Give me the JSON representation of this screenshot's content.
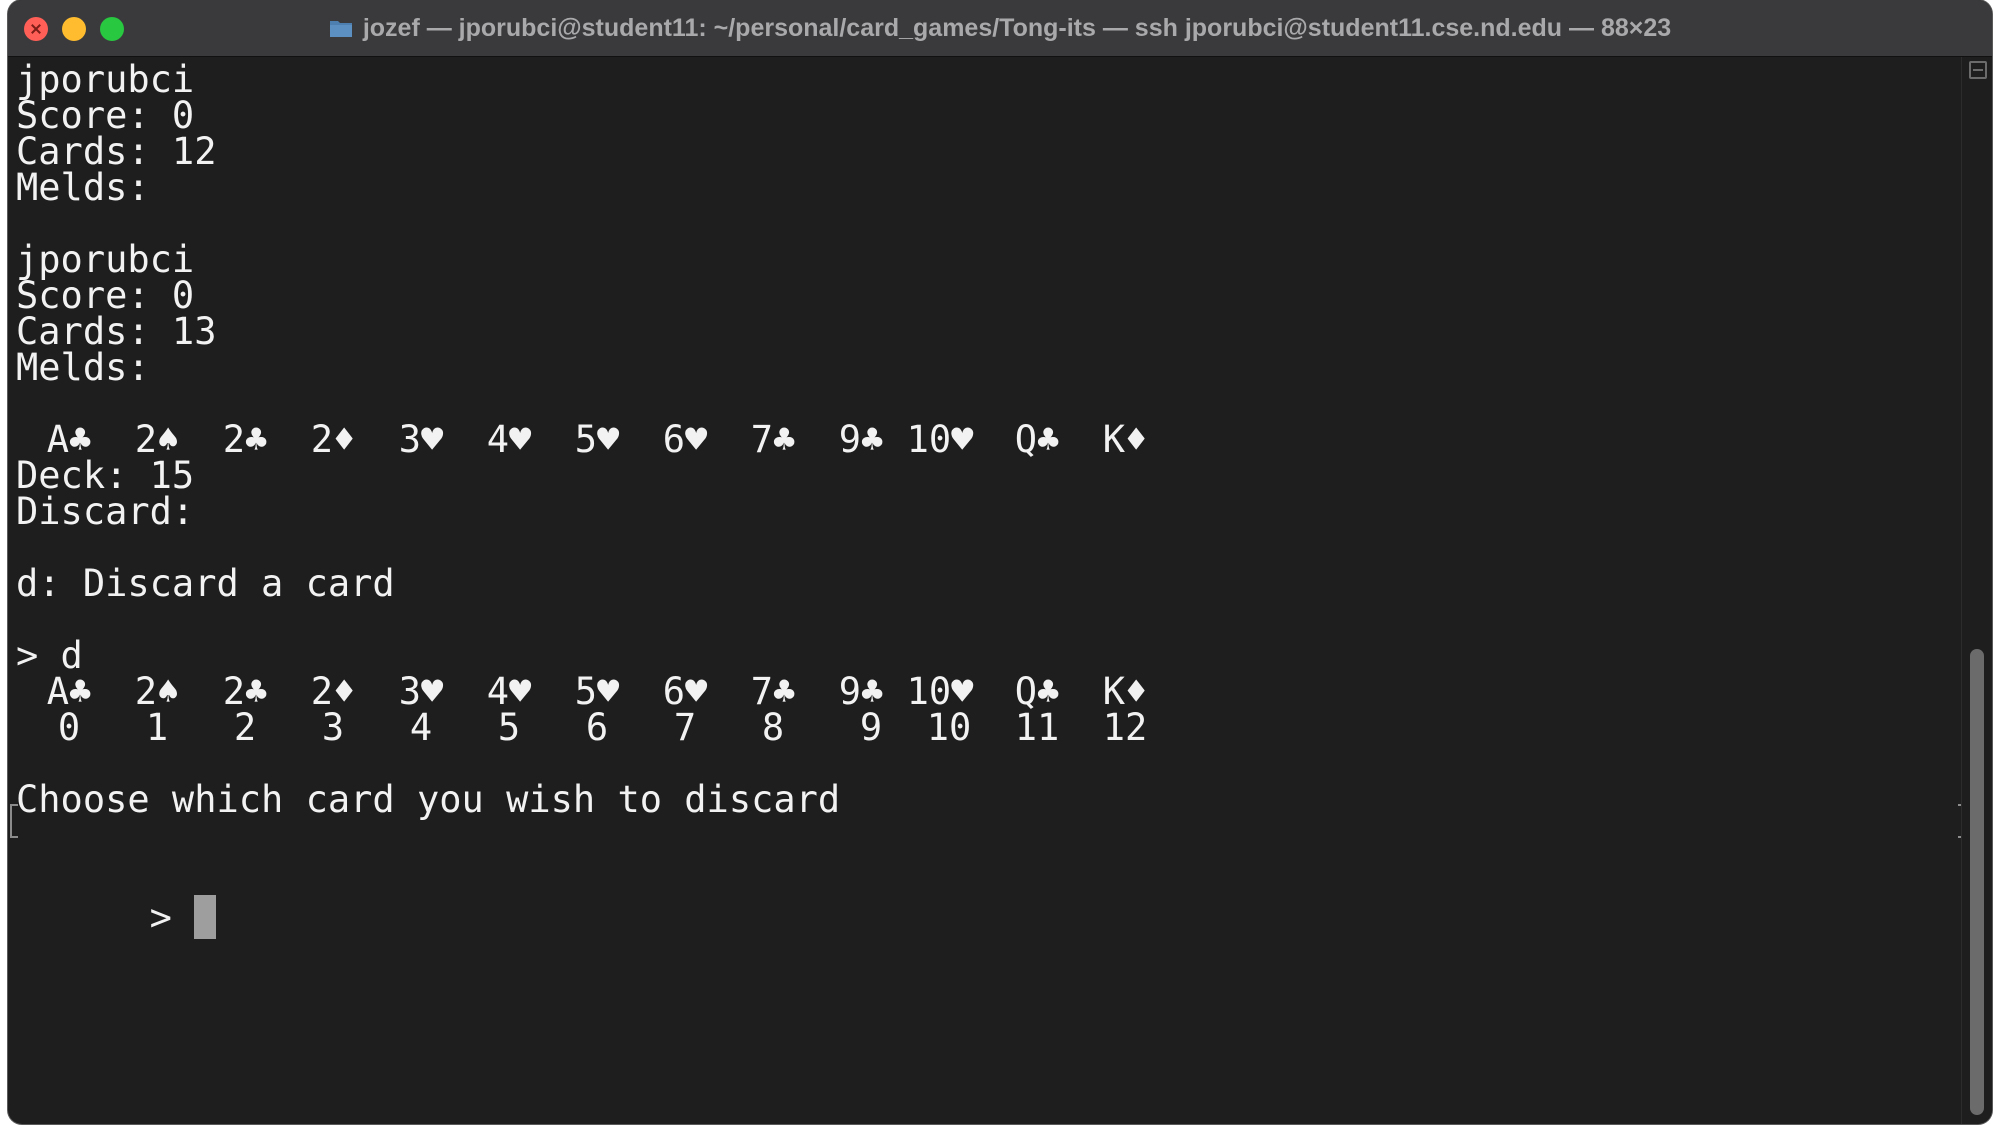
{
  "window": {
    "title": "jozef — jporubci@student11: ~/personal/card_games/Tong-its — ssh jporubci@student11.cse.nd.edu — 88×23"
  },
  "players": [
    {
      "name": "jporubci",
      "score": "Score: 0",
      "cards": "Cards: 12",
      "melds": "Melds:"
    },
    {
      "name": "jporubci",
      "score": "Score: 0",
      "cards": "Cards: 13",
      "melds": "Melds:"
    }
  ],
  "hand": [
    "A♣",
    "2♠",
    "2♣",
    "2♦",
    "3♥",
    "4♥",
    "5♥",
    "6♥",
    "7♣",
    "9♣",
    "10♥",
    "Q♣",
    "K♦"
  ],
  "indices": [
    "0",
    "1",
    "2",
    "3",
    "4",
    "5",
    "6",
    "7",
    "8",
    "9",
    "10",
    "11",
    "12"
  ],
  "deck": "Deck: 15",
  "discard": "Discard:",
  "menu_option": "d: Discard a card",
  "command_line": "> d",
  "choose_prompt": "Choose which card you wish to discard",
  "input_prompt": ">",
  "colors": {
    "background": "#1e1e1e",
    "text": "#f2f2f2",
    "titlebar": "#3a3a3c"
  },
  "icons": {
    "title_icon": "folder-icon",
    "close": "close-icon",
    "minimize": "minimize-icon",
    "maximize": "maximize-icon"
  }
}
